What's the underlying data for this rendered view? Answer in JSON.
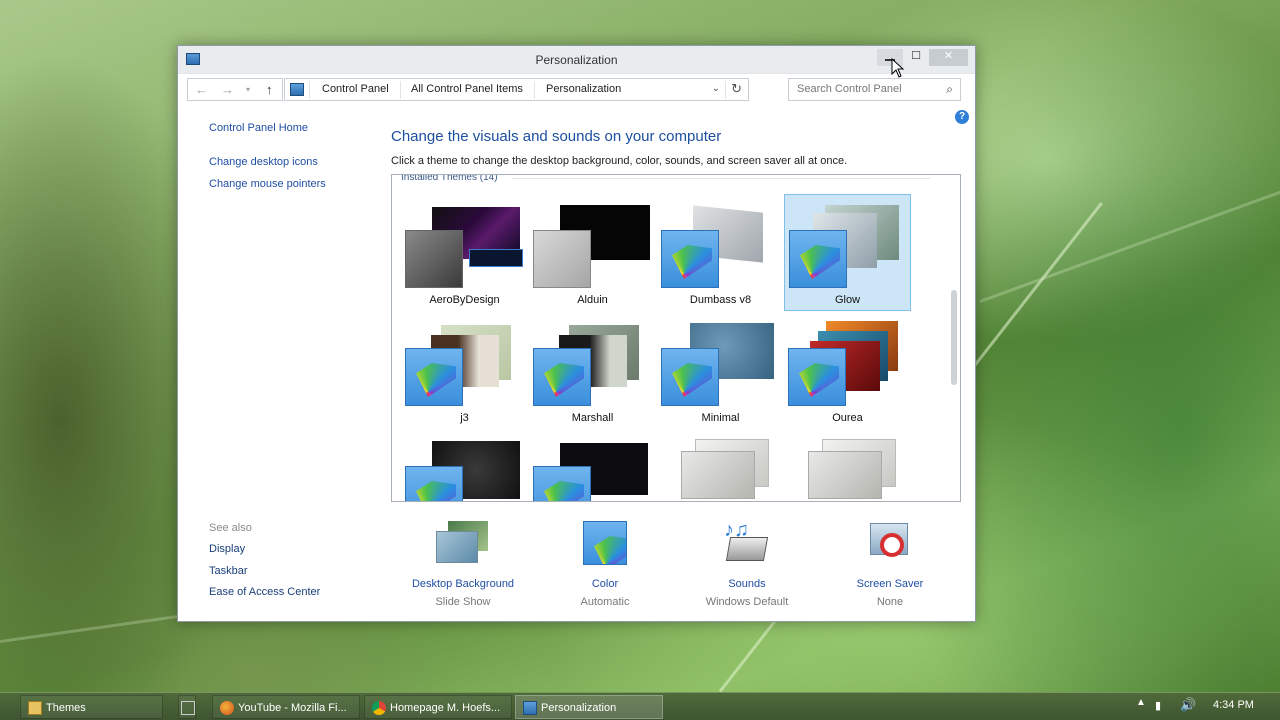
{
  "window": {
    "title": "Personalization",
    "address": [
      "Control Panel",
      "All Control Panel Items",
      "Personalization"
    ],
    "search_placeholder": "Search Control Panel"
  },
  "left_pane": {
    "home": "Control Panel Home",
    "links": [
      "Change desktop icons",
      "Change mouse pointers"
    ],
    "see_also_label": "See also",
    "see_also": [
      "Display",
      "Taskbar",
      "Ease of Access Center"
    ]
  },
  "main": {
    "title": "Change the visuals and sounds on your computer",
    "subtitle": "Click a theme to change the desktop background, color, sounds, and screen saver all at once.",
    "themes_header": "Installed Themes (14)",
    "themes": [
      {
        "name": "AeroByDesign"
      },
      {
        "name": "Alduin"
      },
      {
        "name": "Dumbass v8"
      },
      {
        "name": "Glow"
      },
      {
        "name": "j3"
      },
      {
        "name": "Marshall"
      },
      {
        "name": "Minimal"
      },
      {
        "name": "Ourea"
      }
    ],
    "selected_theme": "Glow"
  },
  "bottom": {
    "desktop_background": {
      "label": "Desktop Background",
      "value": "Slide Show"
    },
    "color": {
      "label": "Color",
      "value": "Automatic"
    },
    "sounds": {
      "label": "Sounds",
      "value": "Windows Default"
    },
    "screen_saver": {
      "label": "Screen Saver",
      "value": "None"
    }
  },
  "taskbar": {
    "items": [
      "Themes",
      "YouTube - Mozilla Fi...",
      "Homepage M. Hoefs...",
      "Personalization"
    ],
    "clock": "4:34 PM"
  }
}
